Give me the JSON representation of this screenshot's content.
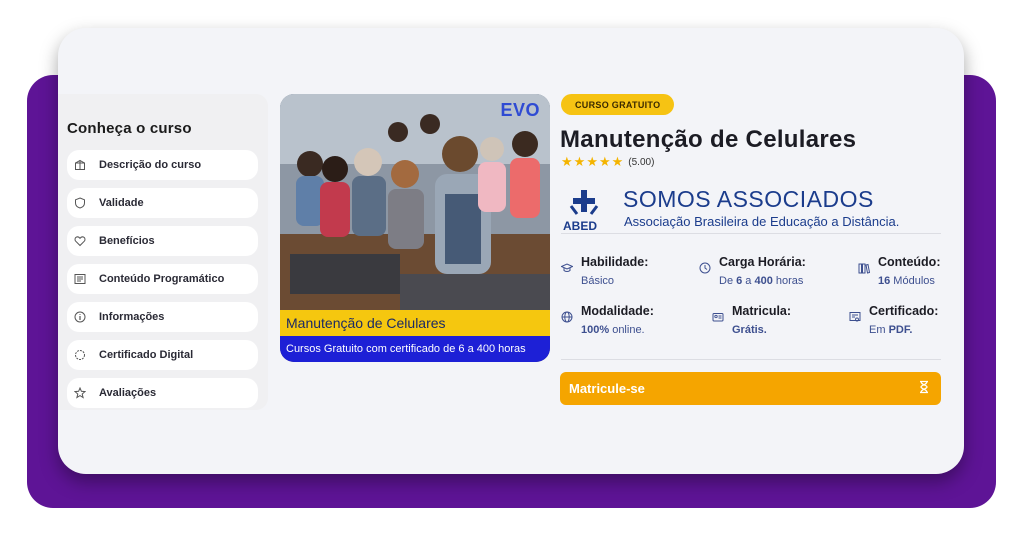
{
  "sidebar": {
    "title": "Conheça o curso",
    "items": [
      {
        "label": "Descrição do curso",
        "icon": "box-icon"
      },
      {
        "label": "Validade",
        "icon": "shield-icon"
      },
      {
        "label": "Benefícios",
        "icon": "heart-icon"
      },
      {
        "label": "Conteúdo Programático",
        "icon": "list-icon"
      },
      {
        "label": "Informações",
        "icon": "info-icon"
      },
      {
        "label": "Certificado Digital",
        "icon": "certificate-icon"
      },
      {
        "label": "Avaliações",
        "icon": "star-outline-icon"
      }
    ]
  },
  "banner": {
    "logo_text": "EVO",
    "caption_title": "Manutenção de Celulares",
    "caption_sub": "Cursos Gratuito com certificado de 6 a 400 horas"
  },
  "course": {
    "badge": "CURSO GRATUITO",
    "title": "Manutenção de Celulares",
    "stars": 5,
    "rating": "(5.00)"
  },
  "partner": {
    "logo_text": "ABED",
    "title": "SOMOS ASSOCIADOS",
    "subtitle": "Associação Brasileira de Educação a Distância."
  },
  "details": {
    "habilidade": {
      "label": "Habilidade:",
      "value": "Básico"
    },
    "carga": {
      "label": "Carga Horária:",
      "value_pre": "De ",
      "value_a": "6",
      "value_mid": " a ",
      "value_b": "400",
      "value_post": " horas"
    },
    "conteudo": {
      "label": "Conteúdo:",
      "value_a": "16",
      "value_post": " Módulos"
    },
    "modalidade": {
      "label": "Modalidade:",
      "value_a": "100%",
      "value_post": " online."
    },
    "matricula": {
      "label": "Matricula:",
      "value": "Grátis."
    },
    "certificado": {
      "label": "Certificado:",
      "value_pre": "Em ",
      "value_a": "PDF."
    }
  },
  "cta": {
    "label": "Matricule-se"
  },
  "colors": {
    "purple": "#5e1496",
    "accent": "#f5a500",
    "badge": "#f6c313",
    "link": "#3d4f8f"
  }
}
